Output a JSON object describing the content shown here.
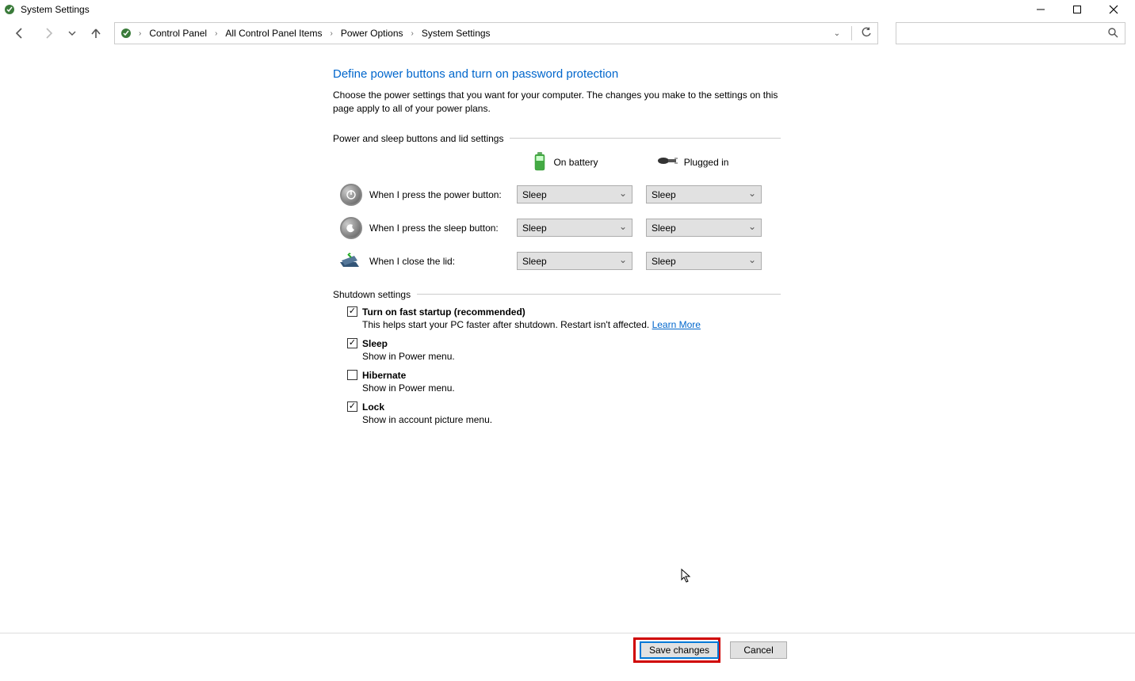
{
  "window": {
    "title": "System Settings"
  },
  "breadcrumb": {
    "items": [
      "Control Panel",
      "All Control Panel Items",
      "Power Options",
      "System Settings"
    ]
  },
  "search": {
    "placeholder": ""
  },
  "main": {
    "heading": "Define power buttons and turn on password protection",
    "description": "Choose the power settings that you want for your computer. The changes you make to the settings on this page apply to all of your power plans.",
    "group1": {
      "label": "Power and sleep buttons and lid settings",
      "col_battery": "On battery",
      "col_plugged": "Plugged in",
      "rows": [
        {
          "label": "When I press the power button:",
          "battery": "Sleep",
          "plugged": "Sleep"
        },
        {
          "label": "When I press the sleep button:",
          "battery": "Sleep",
          "plugged": "Sleep"
        },
        {
          "label": "When I close the lid:",
          "battery": "Sleep",
          "plugged": "Sleep"
        }
      ]
    },
    "group2": {
      "label": "Shutdown settings",
      "items": [
        {
          "checked": true,
          "label": "Turn on fast startup (recommended)",
          "desc": "This helps start your PC faster after shutdown. Restart isn't affected. ",
          "link": "Learn More"
        },
        {
          "checked": true,
          "label": "Sleep",
          "desc": "Show in Power menu."
        },
        {
          "checked": false,
          "label": "Hibernate",
          "desc": "Show in Power menu."
        },
        {
          "checked": true,
          "label": "Lock",
          "desc": "Show in account picture menu."
        }
      ]
    }
  },
  "footer": {
    "save": "Save changes",
    "cancel": "Cancel"
  }
}
